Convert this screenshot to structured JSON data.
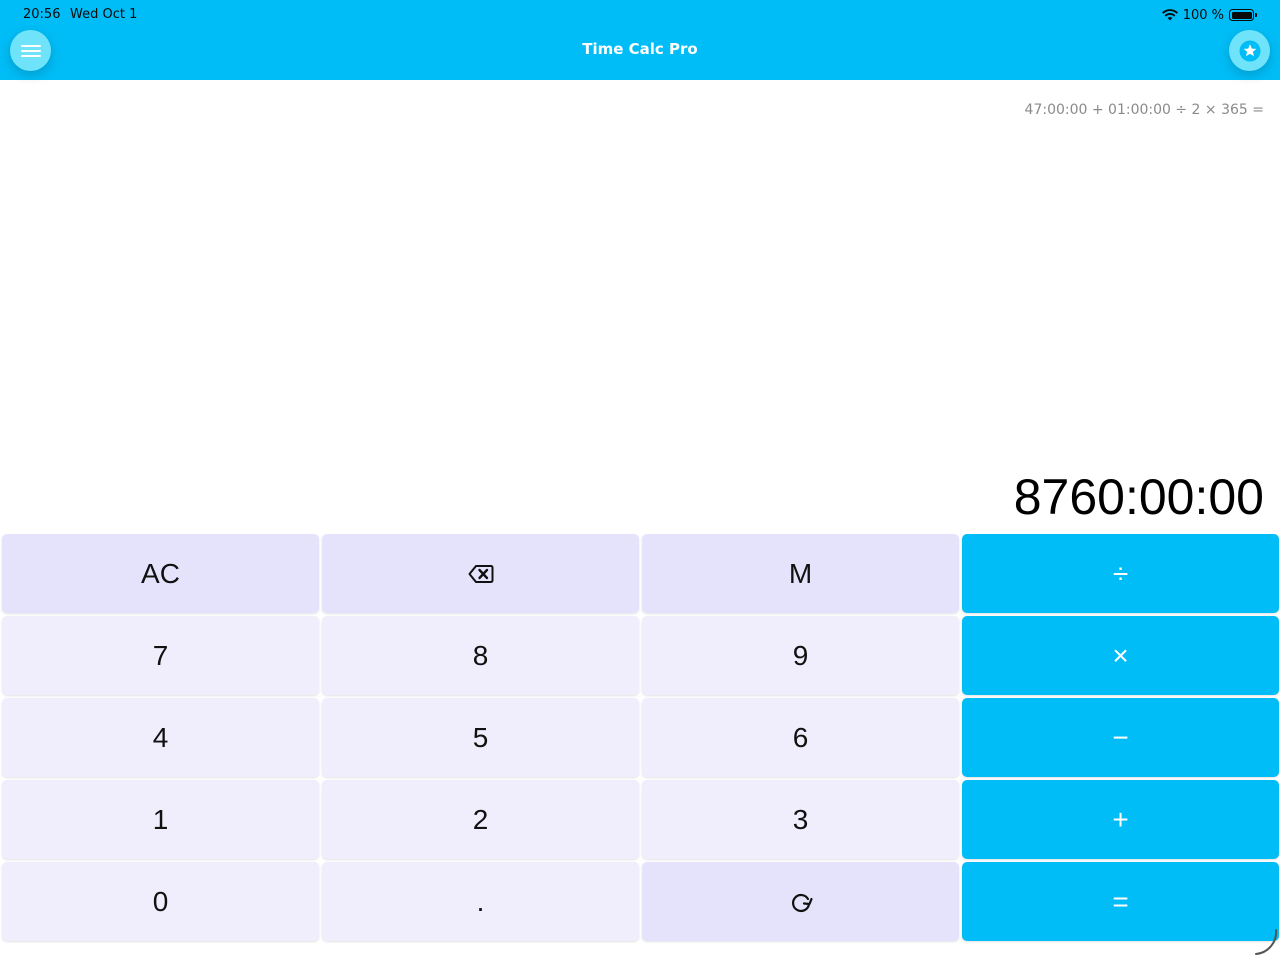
{
  "status_bar": {
    "time": "20:56",
    "date": "Wed Oct 1",
    "battery_text": "100 %",
    "icons": [
      "wifi-icon",
      "battery-icon"
    ]
  },
  "header": {
    "title": "Time Calc Pro",
    "left_button_icon": "menu-icon",
    "right_button_icon": "star-icon"
  },
  "display": {
    "expression": "47:00:00 + 01:00:00 ÷ 2 × 365 =",
    "result": "8760:00:00"
  },
  "keypad": {
    "row1": {
      "clear": "AC",
      "backspace_icon": "backspace-icon",
      "memory": "M",
      "divide": "÷"
    },
    "row2": {
      "seven": "7",
      "eight": "8",
      "nine": "9",
      "multiply": "×"
    },
    "row3": {
      "four": "4",
      "five": "5",
      "six": "6",
      "minus": "−"
    },
    "row4": {
      "one": "1",
      "two": "2",
      "three": "3",
      "plus": "+"
    },
    "row5": {
      "zero": "0",
      "decimal": ".",
      "cycle_icon": "cycle-icon",
      "equals": "="
    }
  },
  "colors": {
    "accent": "#00bdf7",
    "header_button": "#6ee3f9",
    "key_light": "#f0eefc",
    "key_mid": "#e5e3fc",
    "expression_text": "#8a8a8a"
  }
}
